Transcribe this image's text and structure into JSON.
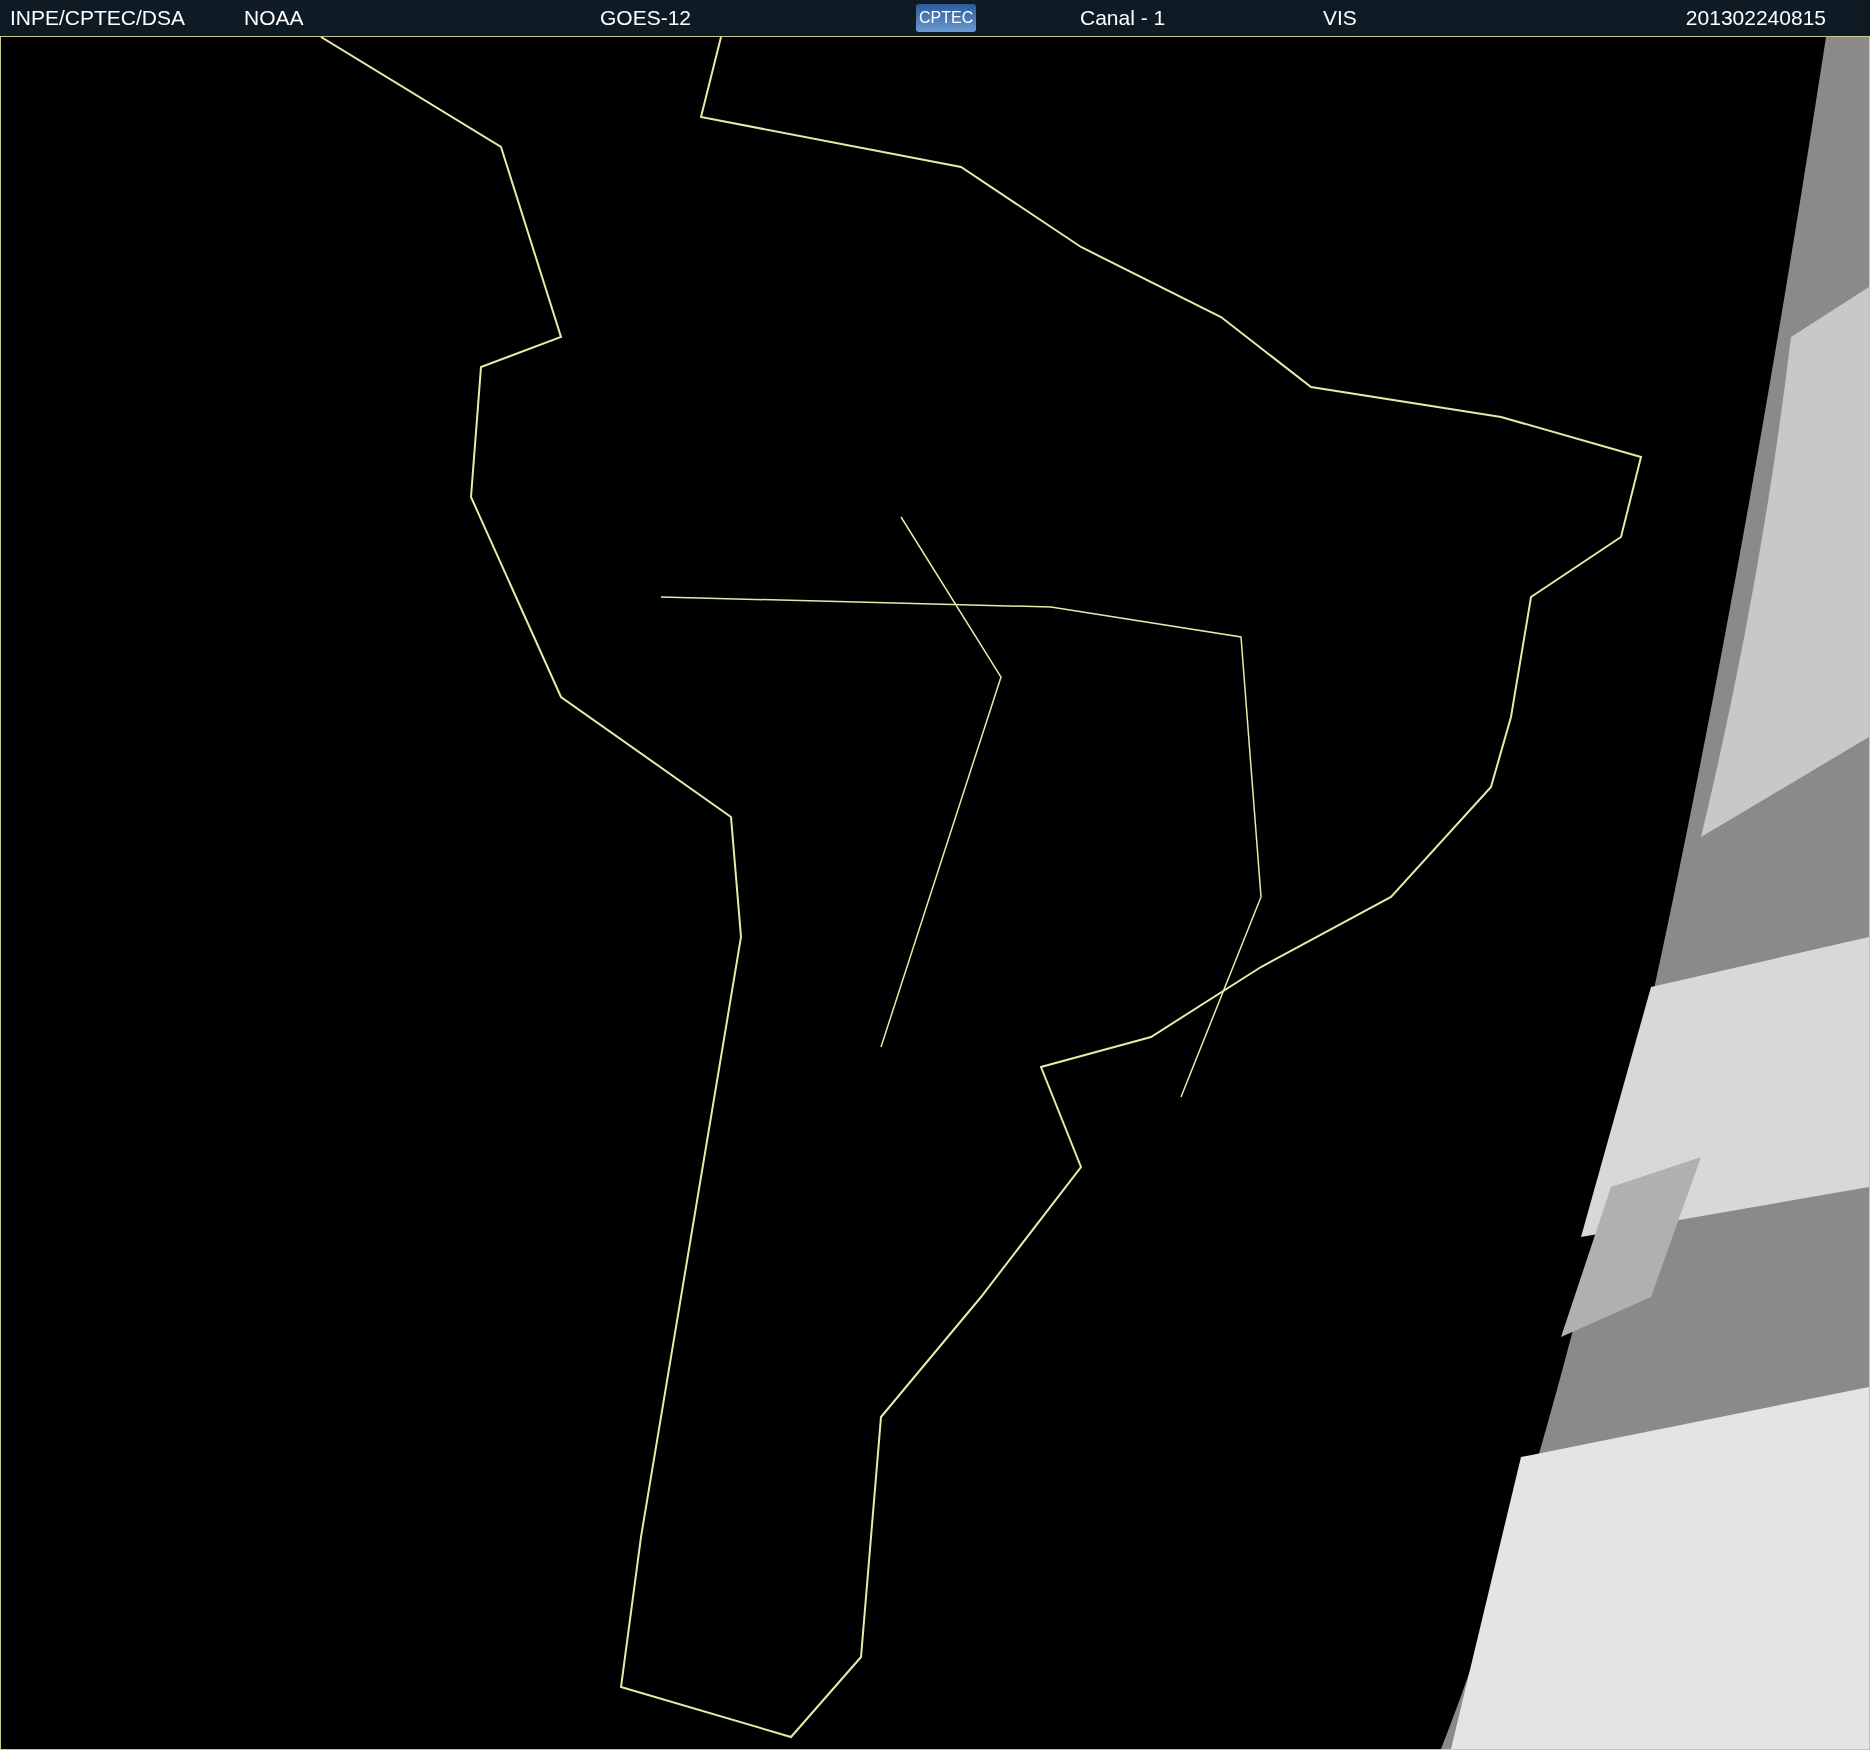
{
  "header": {
    "items": [
      {
        "kind": "text",
        "text": "INPE/CPTEC/DSA"
      },
      {
        "kind": "text",
        "text": "NOAA"
      },
      {
        "kind": "text",
        "text": "GOES-12"
      },
      {
        "kind": "logo",
        "text": "CPTEC"
      },
      {
        "kind": "text",
        "text": "Canal - 1"
      },
      {
        "kind": "text",
        "text": "VIS"
      },
      {
        "kind": "text",
        "text": "201302240815"
      }
    ]
  }
}
